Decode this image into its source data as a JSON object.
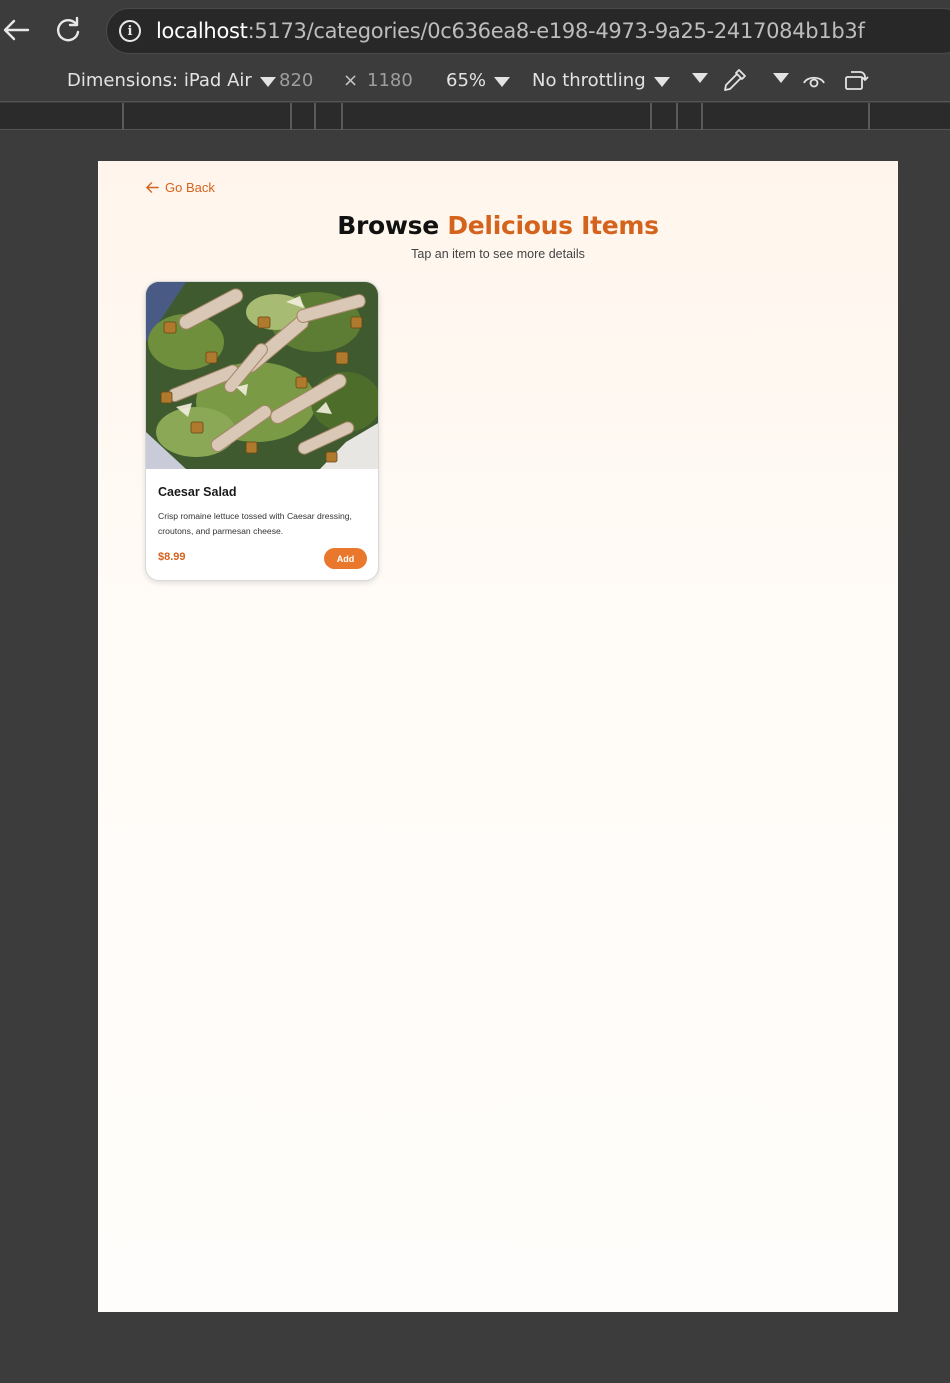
{
  "browser": {
    "url_host": "localhost",
    "url_rest": ":5173/categories/0c636ea8-e198-4973-9a25-2417084b1b3f"
  },
  "device_toolbar": {
    "dimensions_label": "Dimensions: iPad Air",
    "width": "820",
    "times": "×",
    "height": "1180",
    "zoom": "65%",
    "throttling": "No throttling"
  },
  "page": {
    "go_back": "Go Back",
    "title_plain": "Browse",
    "title_accent": "Delicious Items",
    "subtitle": "Tap an item to see more details",
    "items": [
      {
        "name": "Caesar Salad",
        "description": "Crisp romaine lettuce tossed with Caesar dressing, croutons, and parmesan cheese.",
        "price": "$8.99",
        "add_label": "Add"
      }
    ]
  },
  "colors": {
    "accent": "#d4631d",
    "button": "#e9782c"
  }
}
